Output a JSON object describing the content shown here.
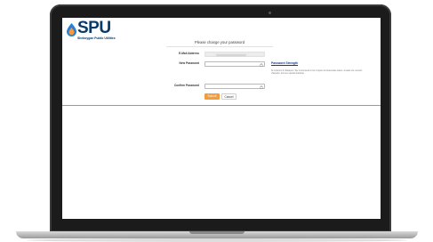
{
  "logo": {
    "wordmark": "SPU",
    "subtitle": "Sheboygan Public Utilities",
    "colors": {
      "text": "#0b3a66",
      "drop_blue": "#2a7fd4",
      "drop_orange": "#f39c3c"
    }
  },
  "form": {
    "title": "Please change your password",
    "fields": {
      "email": {
        "label": "E-Mail Address",
        "value": ""
      },
      "new_password": {
        "label": "New Password",
        "value": ""
      },
      "confirm_password": {
        "label": "Confirm Password",
        "value": ""
      }
    },
    "password_strength": {
      "title": "Password Strength",
      "description": "At minimum 8 characters. We recommend a mix of upper and lowercase letters, at least one numeric character, and one special character."
    },
    "buttons": {
      "submit": "Submit",
      "cancel": "Cancel"
    },
    "accent_color": "#f39c3c"
  }
}
